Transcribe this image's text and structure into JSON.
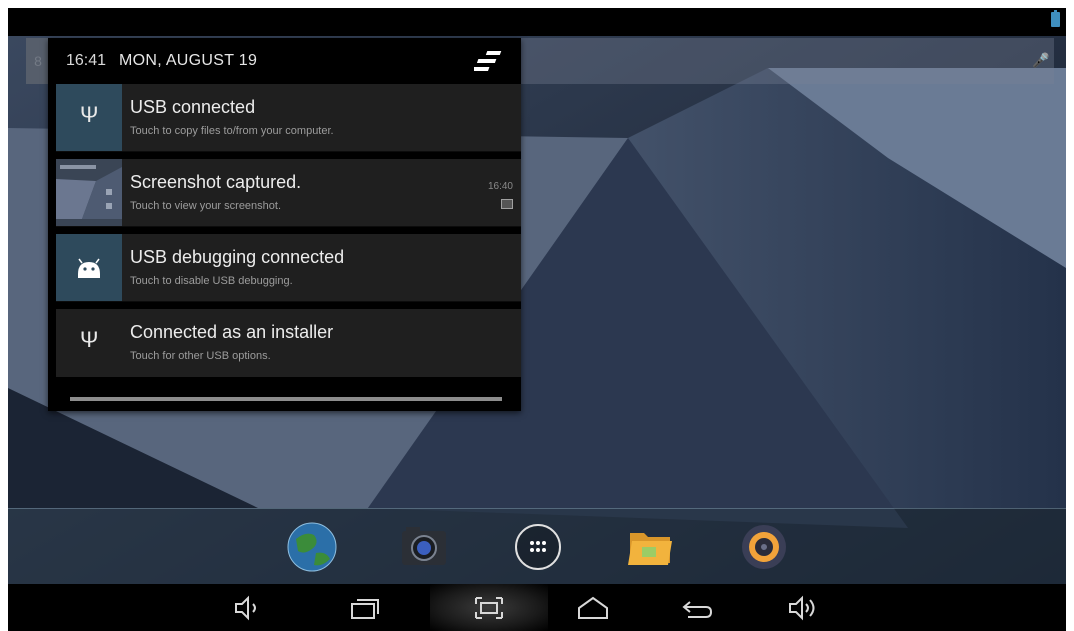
{
  "status_bar": {
    "time": "16:41",
    "date": "MON, AUGUST 19"
  },
  "notifications": [
    {
      "title": "USB connected",
      "text": "Touch to copy files to/from your computer.",
      "icon": "usb-icon"
    },
    {
      "title": "Screenshot captured.",
      "text": "Touch to view your screenshot.",
      "time": "16:40",
      "icon": "screenshot-thumbnail"
    },
    {
      "title": "USB debugging connected",
      "text": "Touch to disable USB debugging.",
      "icon": "android-icon"
    },
    {
      "title": "Connected as an installer",
      "text": "Touch for other USB options.",
      "icon": "usb-icon"
    }
  ],
  "dock": {
    "apps": [
      "browser-icon",
      "camera-icon",
      "app-drawer-icon",
      "file-manager-icon",
      "music-icon"
    ]
  },
  "nav_bar": {
    "buttons": [
      "volume-down-icon",
      "recent-apps-icon",
      "screenshot-icon",
      "home-icon",
      "back-icon",
      "volume-up-icon"
    ]
  },
  "colors": {
    "accent": "#33b5e5",
    "notification_bg": "#1f1f1f",
    "icon_box_blue": "#2e4a5c"
  }
}
